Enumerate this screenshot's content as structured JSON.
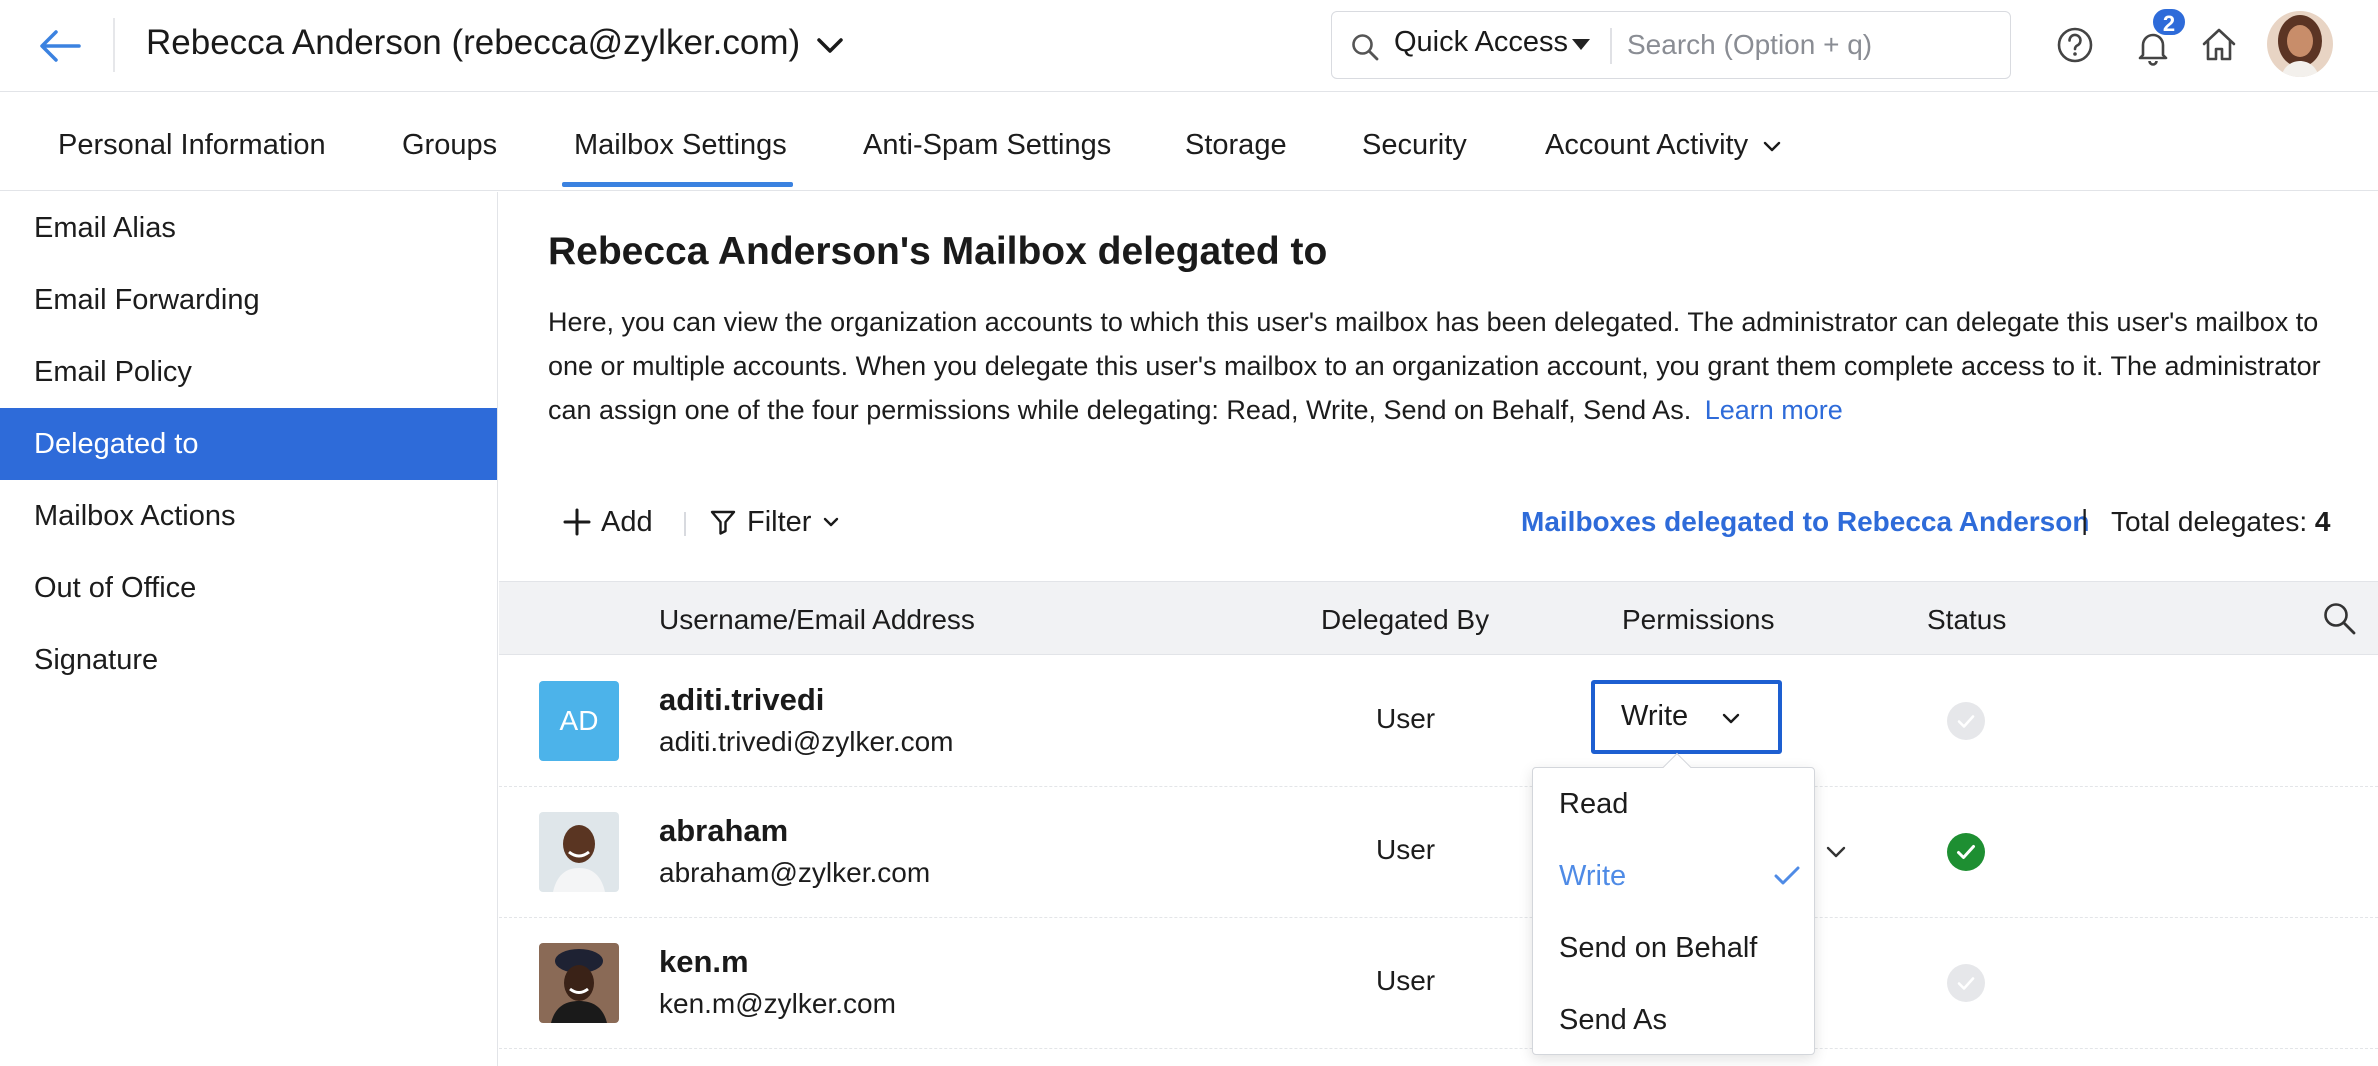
{
  "header": {
    "account_title": "Rebecca Anderson (rebecca@zylker.com)",
    "quick_access": "Quick Access",
    "search_placeholder": "Search (Option + q)",
    "notification_count": "2"
  },
  "tabs": [
    {
      "label": "Personal Information"
    },
    {
      "label": "Groups"
    },
    {
      "label": "Mailbox Settings",
      "active": true
    },
    {
      "label": "Anti-Spam Settings"
    },
    {
      "label": "Storage"
    },
    {
      "label": "Security"
    },
    {
      "label": "Account Activity"
    }
  ],
  "sidebar": {
    "items": [
      {
        "label": "Email Alias"
      },
      {
        "label": "Email Forwarding"
      },
      {
        "label": "Email Policy"
      },
      {
        "label": "Delegated to",
        "active": true
      },
      {
        "label": "Mailbox Actions"
      },
      {
        "label": "Out of Office"
      },
      {
        "label": "Signature"
      }
    ]
  },
  "main": {
    "title": "Rebecca Anderson's Mailbox delegated to",
    "description": "Here, you can view the organization accounts to which this user's mailbox has been delegated. The administrator can delegate this user's mailbox to one or multiple accounts. When you delegate this user's mailbox to an organization account, you grant them complete access to it. The administrator can assign one of the four permissions while delegating: Read, Write, Send on Behalf, Send As.",
    "learn_more": "Learn more",
    "toolbar": {
      "add_label": "Add",
      "filter_label": "Filter",
      "delegated_link": "Mailboxes delegated to Rebecca Anderson",
      "separator": "|",
      "total_label": "Total delegates:",
      "total_count": "4"
    },
    "table": {
      "columns": [
        "Username/Email Address",
        "Delegated By",
        "Permissions",
        "Status"
      ],
      "rows": [
        {
          "initials": "AD",
          "username": "aditi.trivedi",
          "email": "aditi.trivedi@zylker.com",
          "delegated_by": "User",
          "permission": "Write",
          "status": "inactive"
        },
        {
          "username": "abraham",
          "email": "abraham@zylker.com",
          "delegated_by": "User",
          "status": "active"
        },
        {
          "username": "ken.m",
          "email": "ken.m@zylker.com",
          "delegated_by": "User",
          "status": "inactive"
        }
      ]
    },
    "permission_dropdown": {
      "options": [
        "Read",
        "Write",
        "Send on Behalf",
        "Send As"
      ],
      "selected": "Write"
    }
  },
  "colors": {
    "accent": "#2e6bd9",
    "status_active": "#1e8f32",
    "status_inactive": "#e6e7ea",
    "initials_bg": "#4cb3ea"
  }
}
